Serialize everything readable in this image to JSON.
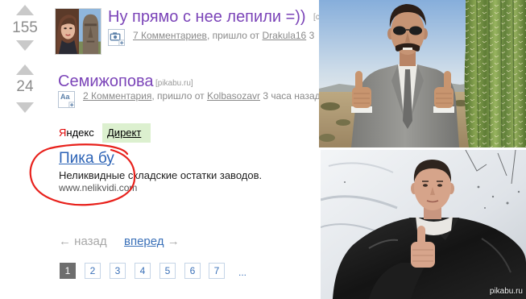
{
  "page": {
    "watermark": "pikabu.ru"
  },
  "colors": {
    "post_title": "#7b44b8",
    "meta_text": "#8a8a8a",
    "ad_link": "#2c63b6",
    "direct_badge_bg": "#dcf0cf",
    "yandex_red": "#e00000",
    "annotation_circle": "#e8211c",
    "pager_link": "#3a70b8",
    "pager_current_bg": "#6e6e6e"
  },
  "posts": [
    {
      "rating": "155",
      "title": "Ну прямо с нее лепили =))",
      "source": "[c",
      "type_icon": "camera-plus-icon",
      "comments": "7 Комментариев",
      "from_text": ", пришло от",
      "author": "Drakula16",
      "time": "3"
    },
    {
      "rating": "24",
      "title": "Семижопова",
      "source": "[pikabu.ru]",
      "type_icon": "text-plus-icon",
      "type_icon_glyph": "Aa",
      "comments": "2 Комментария",
      "from_text": ", пришло от",
      "author": "Kolbasozavr",
      "time": "3 часа назад"
    }
  ],
  "ad": {
    "brand_first_letter": "Я",
    "brand_rest": "ндекс",
    "direct_label": "Директ",
    "title": "Пика бу",
    "description": "Неликвидные складские остатки заводов.",
    "url": "www.nelikvidi.com"
  },
  "pagination": {
    "prev_label": "← назад",
    "next_label": "вперед",
    "next_arrow": "→",
    "current_page": "1",
    "other_pages": [
      "2",
      "3",
      "4",
      "5",
      "6",
      "7"
    ],
    "ellipsis": "..."
  }
}
